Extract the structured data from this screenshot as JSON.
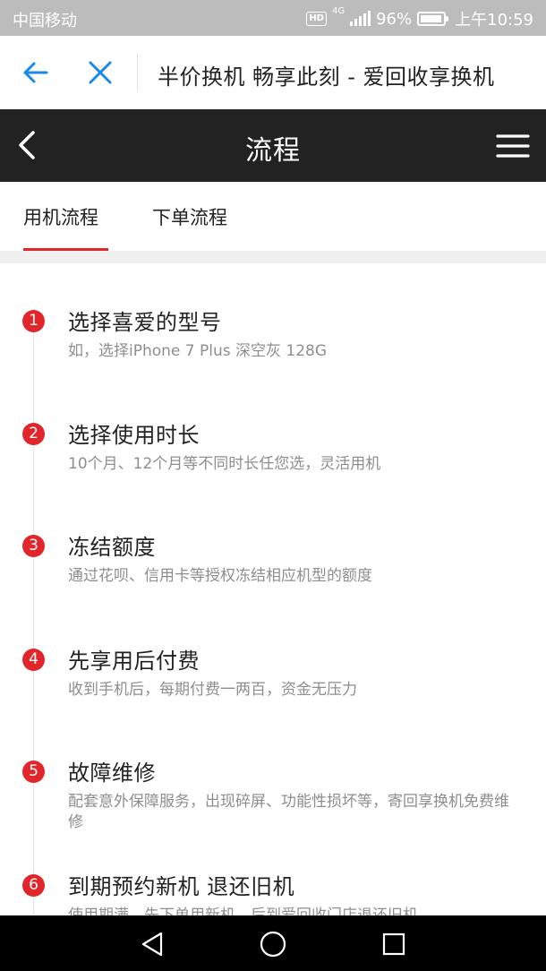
{
  "status_bar": {
    "carrier": "中国移动",
    "hd": "HD",
    "network": "4G",
    "battery": "96%",
    "battery_level": 0.96,
    "time": "上午10:59"
  },
  "browser": {
    "title": "半价换机 畅享此刻 - 爱回收享换机"
  },
  "header": {
    "title": "流程"
  },
  "tabs": [
    {
      "label": "用机流程",
      "active": true
    },
    {
      "label": "下单流程",
      "active": false
    }
  ],
  "steps": [
    {
      "number": "1",
      "title": "选择喜爱的型号",
      "desc": "如，选择iPhone 7 Plus 深空灰 128G"
    },
    {
      "number": "2",
      "title": "选择使用时长",
      "desc": "10个月、12个月等不同时长任您选，灵活用机"
    },
    {
      "number": "3",
      "title": "冻结额度",
      "desc": "通过花呗、信用卡等授权冻结相应机型的额度"
    },
    {
      "number": "4",
      "title": "先享用后付费",
      "desc": "收到手机后，每期付费一两百，资金无压力"
    },
    {
      "number": "5",
      "title": "故障维修",
      "desc": "配套意外保障服务，出现碎屏、功能性损坏等，寄回享换机免费维修"
    },
    {
      "number": "6",
      "title": "到期预约新机 退还旧机",
      "desc": "使用期满，先下单用新机，后到爱回收门店退还旧机"
    }
  ],
  "colors": {
    "accent": "#e0262b",
    "link_blue": "#1a8ae8",
    "header_bg": "#222222"
  }
}
